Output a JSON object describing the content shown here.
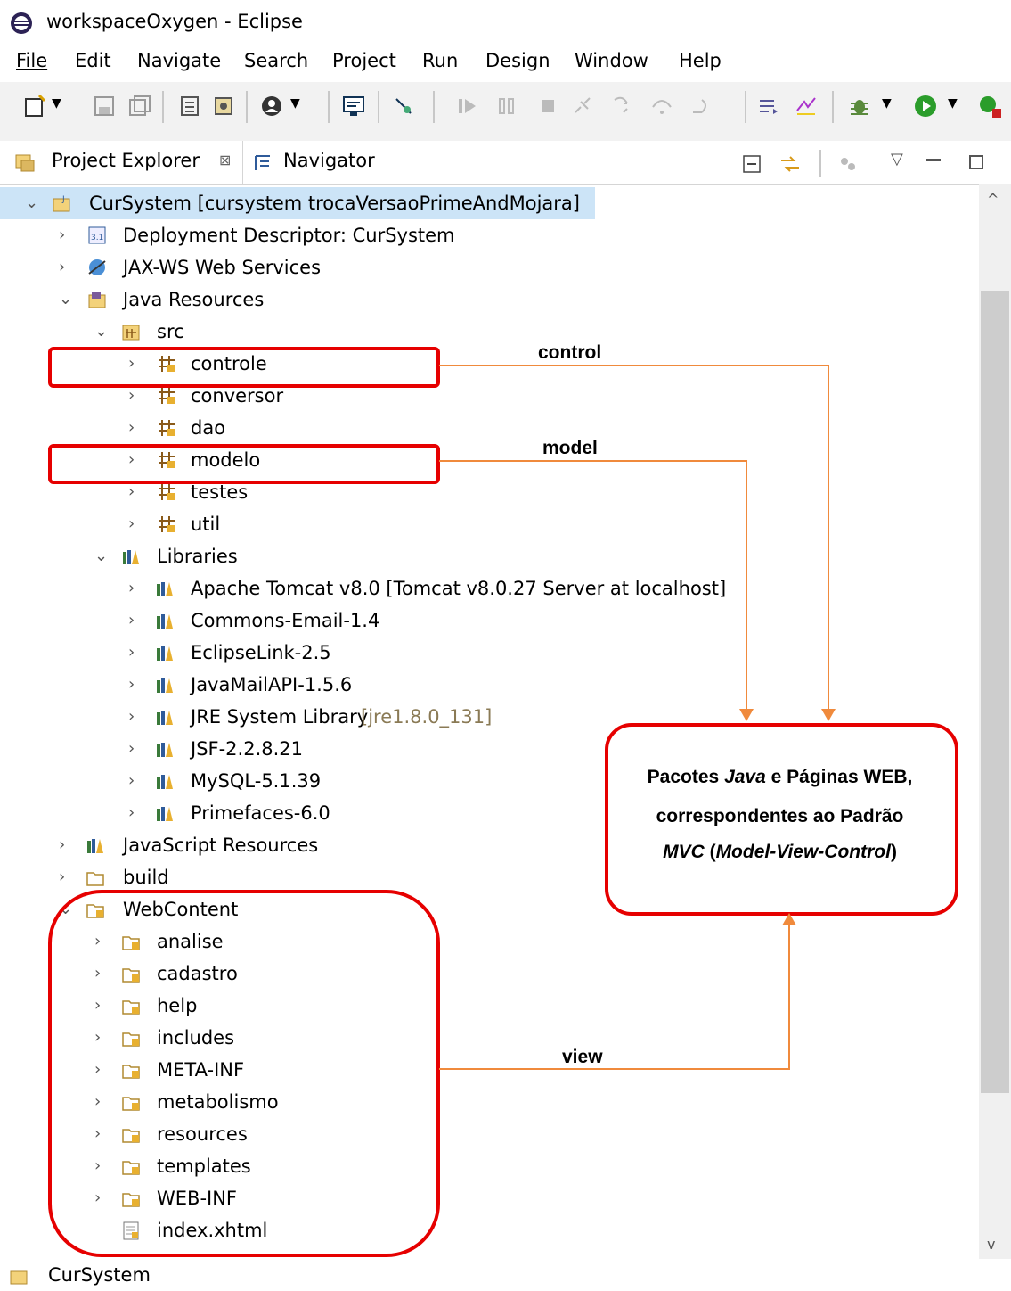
{
  "window": {
    "title": "workspaceOxygen - Eclipse"
  },
  "menu": [
    "File",
    "Edit",
    "Navigate",
    "Search",
    "Project",
    "Run",
    "Design",
    "Window",
    "Help"
  ],
  "tabs": {
    "project_explorer": "Project Explorer",
    "close_glyph": "⊠",
    "navigator": "Navigator"
  },
  "tree": {
    "root": "CurSystem [cursystem trocaVersaoPrimeAndMojara]",
    "deployment": "Deployment Descriptor: CurSystem",
    "jaxws": "JAX-WS Web Services",
    "java_resources": "Java Resources",
    "src": "src",
    "packages": [
      "controle",
      "conversor",
      "dao",
      "modelo",
      "testes",
      "util"
    ],
    "libraries": "Libraries",
    "libs": [
      "Apache Tomcat v8.0 [Tomcat v8.0.27 Server at localhost]",
      "Commons-Email-1.4",
      "EclipseLink-2.5",
      "JavaMailAPI-1.5.6",
      "JRE System Library",
      "JSF-2.2.8.21",
      "MySQL-5.1.39",
      "Primefaces-6.0"
    ],
    "jre_suffix": "[jre1.8.0_131]",
    "javascript": "JavaScript Resources",
    "build": "build",
    "webcontent": "WebContent",
    "web_folders": [
      "analise",
      "cadastro",
      "help",
      "includes",
      "META-INF",
      "metabolismo",
      "resources",
      "templates",
      "WEB-INF"
    ],
    "index": "index.xhtml"
  },
  "status": {
    "text": "CurSystem"
  },
  "annotations": {
    "control": "control",
    "model": "model",
    "view": "view",
    "box_line1_a": "Pacotes ",
    "box_line1_b": "Java",
    "box_line1_c": " e Páginas WEB,",
    "box_line2": "correspondentes ao Padrão",
    "box_line3_a": "MVC",
    "box_line3_b": " (",
    "box_line3_c": "Model-View-Control",
    "box_line3_d": ")"
  },
  "colors": {
    "highlight": "#e60000",
    "arrow": "#f08a3c",
    "selection": "#cce4f7"
  }
}
